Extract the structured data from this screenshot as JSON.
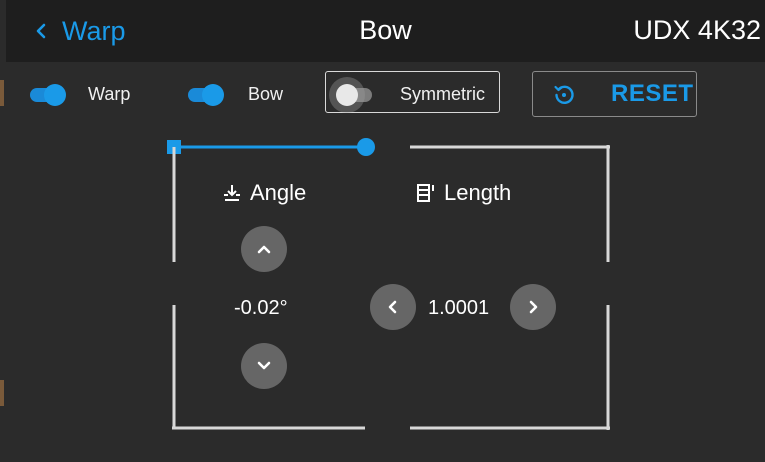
{
  "header": {
    "back_label": "Warp",
    "title": "Bow",
    "device": "UDX 4K32"
  },
  "toolbar": {
    "warp_toggle": {
      "label": "Warp",
      "state": "on"
    },
    "bow_toggle": {
      "label": "Bow",
      "state": "on"
    },
    "symmetric_toggle": {
      "label": "Symmetric",
      "state": "off"
    },
    "reset_label": "RESET"
  },
  "angle": {
    "label": "Angle",
    "value": "-0.02°"
  },
  "length": {
    "label": "Length",
    "value": "1.0001"
  },
  "colors": {
    "accent": "#1a9ae8",
    "background": "#2b2b2b",
    "header": "#1e1e1e",
    "button": "#666666"
  },
  "icons": {
    "back": "chevron-left-icon",
    "reset": "reset-icon",
    "angle": "angle-icon",
    "length": "length-icon",
    "up": "chevron-up-icon",
    "down": "chevron-down-icon",
    "left": "chevron-left-icon",
    "right": "chevron-right-icon"
  }
}
